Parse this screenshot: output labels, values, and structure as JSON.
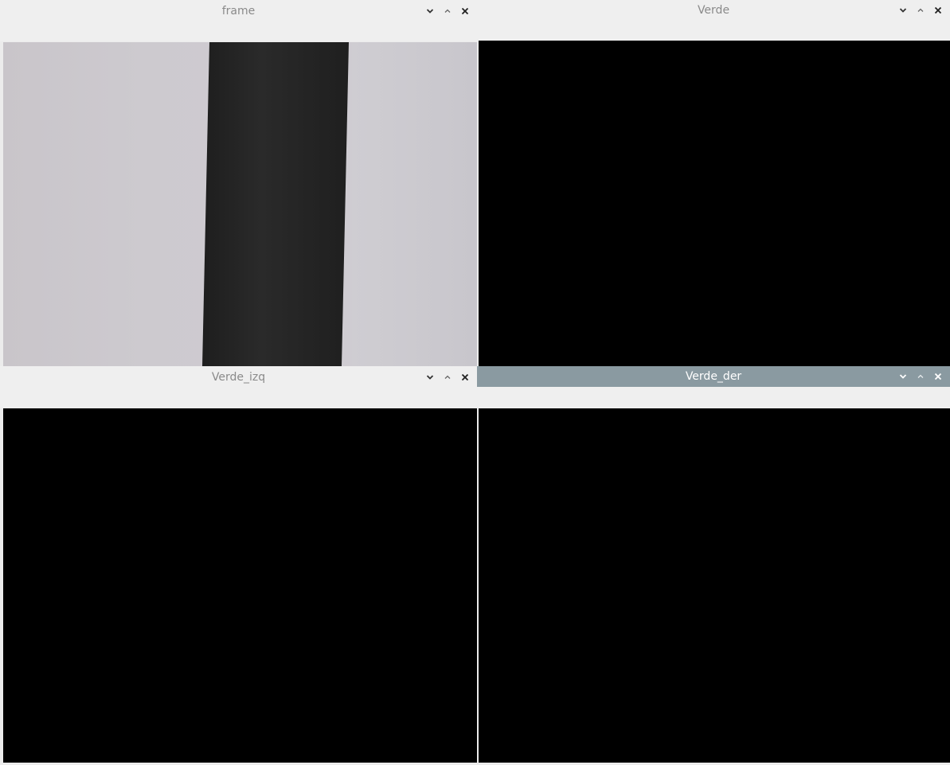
{
  "windows": [
    {
      "id": "frame",
      "title": "frame",
      "active": false,
      "view": "camera"
    },
    {
      "id": "verde",
      "title": "Verde",
      "active": false,
      "view": "black"
    },
    {
      "id": "verde_izq",
      "title": "Verde_izq",
      "active": false,
      "view": "black"
    },
    {
      "id": "verde_der",
      "title": "Verde_der",
      "active": true,
      "view": "black"
    }
  ],
  "controls": {
    "minimize_icon": "chevron-down-icon",
    "maximize_icon": "chevron-up-icon",
    "close_icon": "close-icon"
  },
  "colors": {
    "titlebar_inactive": "#efefef",
    "titlebar_active": "#8a9aa1",
    "title_text_inactive": "#8a8a8a",
    "title_text_active": "#ffffff",
    "image_background": "#000000"
  }
}
